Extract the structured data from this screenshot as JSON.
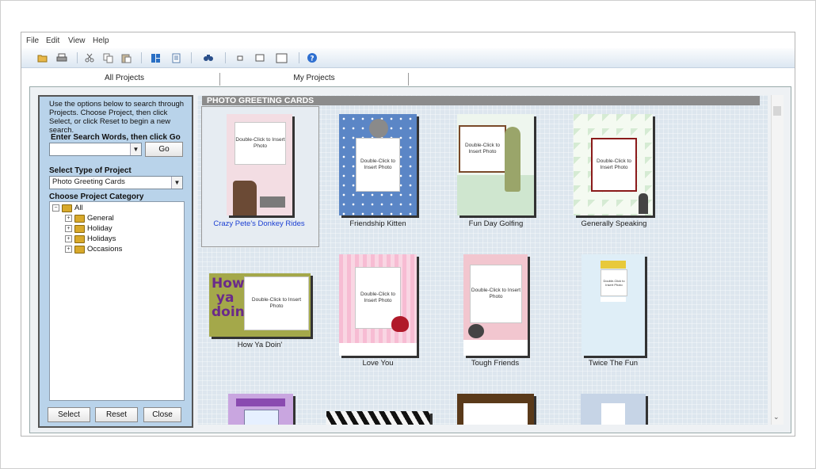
{
  "menu": [
    "File",
    "Edit",
    "View",
    "Help"
  ],
  "toolbar": {
    "icons": [
      "open-icon",
      "print-icon",
      "cut-icon",
      "copy-icon",
      "paste-icon",
      "layout-icon",
      "page-icon",
      "find-icon",
      "size-small-icon",
      "size-medium-icon",
      "size-large-icon",
      "help-icon"
    ]
  },
  "tabs": [
    "All Projects",
    "My Projects"
  ],
  "sidebar": {
    "instructions": "Use the options below to search through Projects. Choose Project, then click Select, or click Reset to begin a new search.",
    "search_label": "Enter Search Words, then click Go",
    "search_value": "",
    "go_label": "Go",
    "type_label": "Select Type of Project",
    "type_value": "Photo Greeting Cards",
    "category_label": "Choose Project Category",
    "tree": {
      "root": "All",
      "children": [
        "General",
        "Holiday",
        "Holidays",
        "Occasions"
      ]
    },
    "select_label": "Select",
    "reset_label": "Reset",
    "close_label": "Close"
  },
  "gallery": {
    "section_title": "PHOTO GREETING CARDS",
    "photo_text": "Double-Click to Insert Photo",
    "cards": [
      "Crazy Pete's Donkey Rides",
      "Friendship Kitten",
      "Fun Day Golfing",
      "Generally Speaking",
      "How Ya Doin'",
      "Love You",
      "Tough Friends",
      "Twice The Fun"
    ]
  },
  "colors": {
    "sidebar_bg": "#b9d3ea",
    "section_header": "#8c8c8c",
    "selected_caption": "#1a3ed2"
  }
}
